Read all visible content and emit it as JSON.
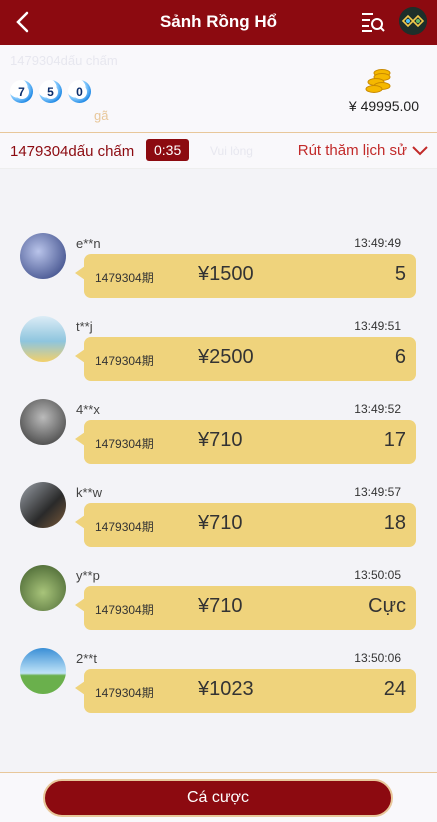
{
  "header": {
    "title": "Sảnh Rồng Hổ",
    "back_icon": "chevron-left-icon",
    "list_icon": "list-search-icon",
    "logo_icon": "logo-icon"
  },
  "info": {
    "faded_label": "1479304dấu chấm",
    "balls": [
      "7",
      "5",
      "0"
    ],
    "sub_label": "gã",
    "balance": "¥ 49995.00",
    "coins_icon": "coins-icon"
  },
  "period": {
    "label": "1479304dấu chấm",
    "countdown": "0:35",
    "faded": "Vui lòng",
    "history_link": "Rút thăm lịch sử",
    "chevron_icon": "chevron-down-icon"
  },
  "feed": [
    {
      "user": "e**n",
      "time": "13:49:49",
      "period": "1479304期",
      "amount": "¥1500",
      "bet": "5",
      "avatar_color": "#3b4a8a"
    },
    {
      "user": "t**j",
      "time": "13:49:51",
      "period": "1479304期",
      "amount": "¥2500",
      "bet": "6",
      "avatar_color": "#8ec5de"
    },
    {
      "user": "4**x",
      "time": "13:49:52",
      "period": "1479304期",
      "amount": "¥710",
      "bet": "17",
      "avatar_color": "#555555"
    },
    {
      "user": "k**w",
      "time": "13:49:57",
      "period": "1479304期",
      "amount": "¥710",
      "bet": "18",
      "avatar_color": "#3a3a3a"
    },
    {
      "user": "y**p",
      "time": "13:50:05",
      "period": "1479304期",
      "amount": "¥710",
      "bet": "Cực",
      "avatar_color": "#5a7a3a"
    },
    {
      "user": "2**t",
      "time": "13:50:06",
      "period": "1479304期",
      "amount": "¥1023",
      "bet": "24",
      "avatar_color": "#4a9ad0"
    }
  ],
  "footer": {
    "bet_button": "Cá cược"
  },
  "colors": {
    "primary": "#8c0a10",
    "bubble": "#efd37c",
    "accent": "#e8c79a"
  }
}
